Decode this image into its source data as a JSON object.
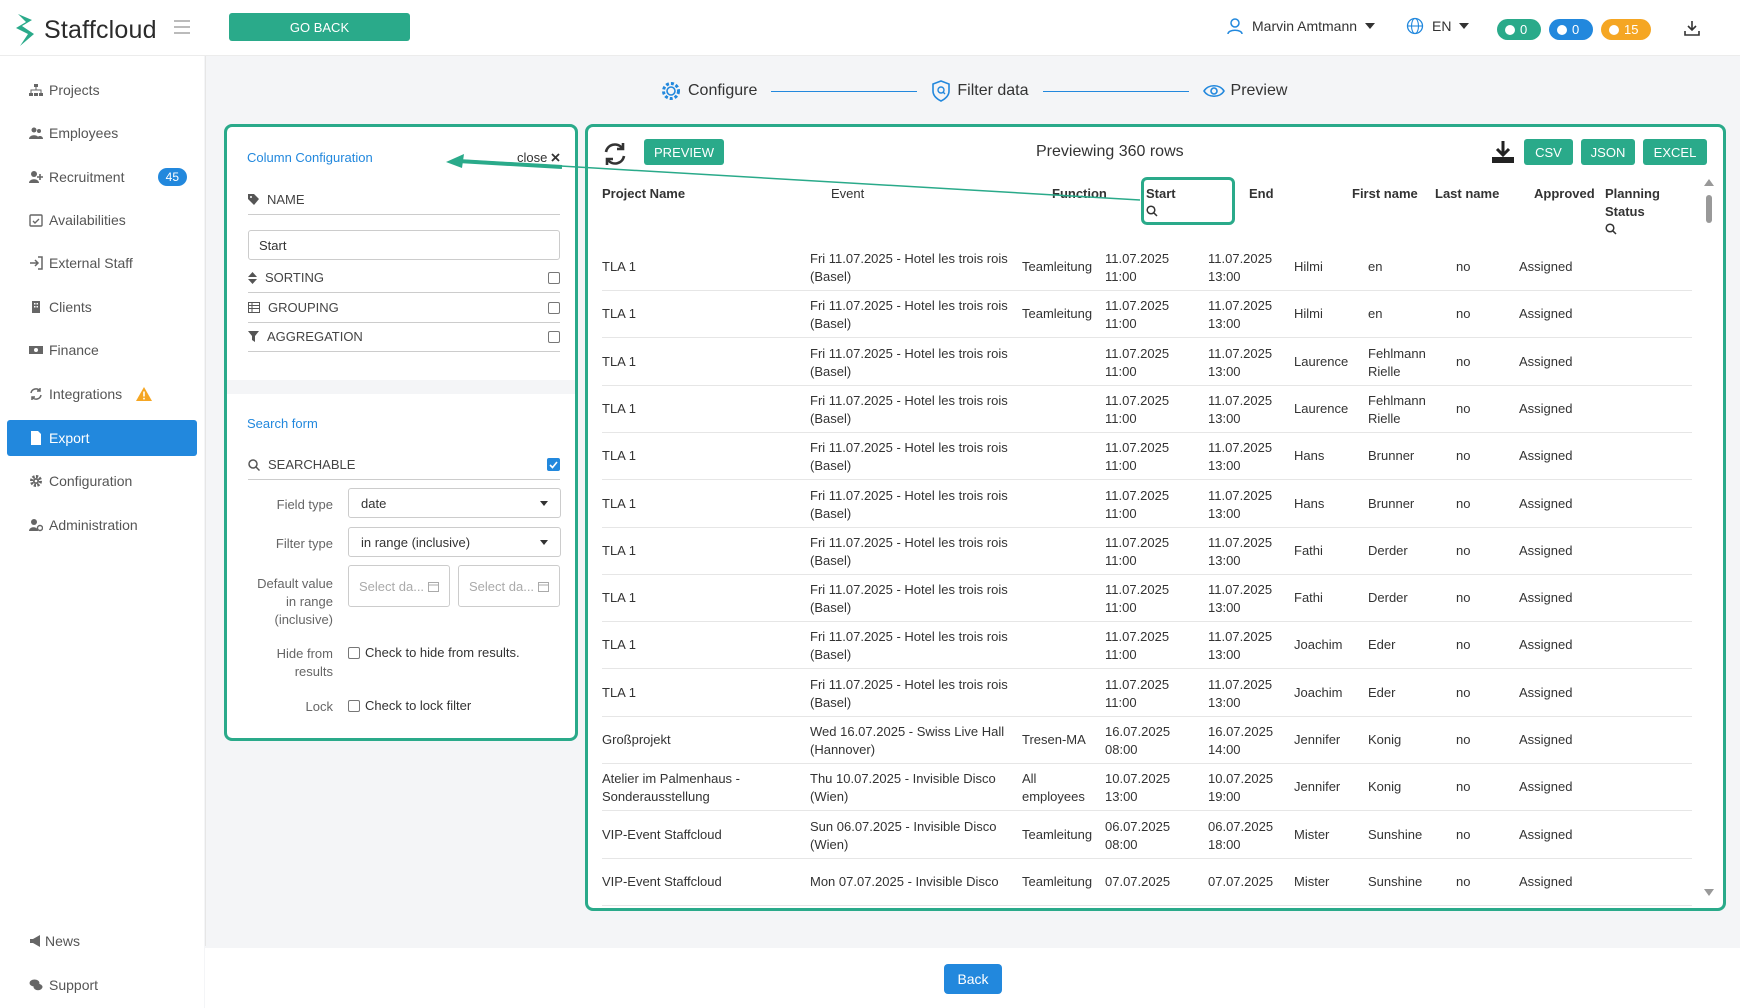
{
  "app": {
    "name": "Staffcloud"
  },
  "header": {
    "go_back_label": "GO BACK",
    "user_name": "Marvin Amtmann",
    "language": "EN",
    "badges": [
      {
        "value": "0",
        "color": "#2aaa8a"
      },
      {
        "value": "0",
        "color": "#2288dd"
      },
      {
        "value": "15",
        "color": "#f5a623"
      }
    ]
  },
  "sidebar": {
    "items": [
      {
        "label": "Projects",
        "icon": "sitemap-icon"
      },
      {
        "label": "Employees",
        "icon": "users-icon"
      },
      {
        "label": "Recruitment",
        "icon": "user-plus-icon",
        "badge": "45"
      },
      {
        "label": "Availabilities",
        "icon": "calendar-check-icon"
      },
      {
        "label": "External Staff",
        "icon": "sign-in-icon"
      },
      {
        "label": "Clients",
        "icon": "building-icon"
      },
      {
        "label": "Finance",
        "icon": "money-icon"
      },
      {
        "label": "Integrations",
        "icon": "sync-icon"
      },
      {
        "label": "Export",
        "icon": "file-icon",
        "active": true
      },
      {
        "label": "Configuration",
        "icon": "gear-icon"
      },
      {
        "label": "Administration",
        "icon": "user-cog-icon"
      }
    ],
    "footer": [
      {
        "label": "News",
        "icon": "megaphone-icon"
      },
      {
        "label": "Support",
        "icon": "comments-icon"
      }
    ]
  },
  "stepper": {
    "steps": [
      "Configure",
      "Filter data",
      "Preview"
    ]
  },
  "column_config": {
    "title": "Column Configuration",
    "close_label": "close",
    "name_label": "NAME",
    "name_value": "Start",
    "sorting_label": "SORTING",
    "grouping_label": "GROUPING",
    "aggregation_label": "AGGREGATION",
    "search_form_title": "Search form",
    "searchable_label": "SEARCHABLE",
    "field_type_label": "Field type",
    "field_type_value": "date",
    "filter_type_label": "Filter type",
    "filter_type_value": "in range (inclusive)",
    "default_value_label": "Default value in range (inclusive)",
    "date_placeholder_1": "Select da...",
    "date_placeholder_2": "Select da...",
    "hide_label": "Hide from results",
    "hide_text": "Check to hide from results.",
    "lock_label": "Lock",
    "lock_text": "Check to lock filter"
  },
  "preview": {
    "preview_button": "PREVIEW",
    "title": "Previewing 360 rows",
    "csv": "CSV",
    "json": "JSON",
    "excel": "EXCEL",
    "columns": [
      "Project Name",
      "Event",
      "Function",
      "Start",
      "End",
      "First name",
      "Last name",
      "Approved",
      "Planning Status"
    ],
    "rows": [
      [
        "TLA 1",
        "Fri 11.07.2025 - Hotel les trois rois (Basel)",
        "Teamleitung",
        "11.07.2025 11:00",
        "11.07.2025 13:00",
        "Hilmi",
        "en",
        "no",
        "Assigned"
      ],
      [
        "TLA 1",
        "Fri 11.07.2025 - Hotel les trois rois (Basel)",
        "Teamleitung",
        "11.07.2025 11:00",
        "11.07.2025 13:00",
        "Hilmi",
        "en",
        "no",
        "Assigned"
      ],
      [
        "TLA 1",
        "Fri 11.07.2025 - Hotel les trois rois (Basel)",
        "",
        "11.07.2025 11:00",
        "11.07.2025 13:00",
        "Laurence",
        "Fehlmann Rielle",
        "no",
        "Assigned"
      ],
      [
        "TLA 1",
        "Fri 11.07.2025 - Hotel les trois rois (Basel)",
        "",
        "11.07.2025 11:00",
        "11.07.2025 13:00",
        "Laurence",
        "Fehlmann Rielle",
        "no",
        "Assigned"
      ],
      [
        "TLA 1",
        "Fri 11.07.2025 - Hotel les trois rois (Basel)",
        "",
        "11.07.2025 11:00",
        "11.07.2025 13:00",
        "Hans",
        "Brunner",
        "no",
        "Assigned"
      ],
      [
        "TLA 1",
        "Fri 11.07.2025 - Hotel les trois rois (Basel)",
        "",
        "11.07.2025 11:00",
        "11.07.2025 13:00",
        "Hans",
        "Brunner",
        "no",
        "Assigned"
      ],
      [
        "TLA 1",
        "Fri 11.07.2025 - Hotel les trois rois (Basel)",
        "",
        "11.07.2025 11:00",
        "11.07.2025 13:00",
        "Fathi",
        "Derder",
        "no",
        "Assigned"
      ],
      [
        "TLA 1",
        "Fri 11.07.2025 - Hotel les trois rois (Basel)",
        "",
        "11.07.2025 11:00",
        "11.07.2025 13:00",
        "Fathi",
        "Derder",
        "no",
        "Assigned"
      ],
      [
        "TLA 1",
        "Fri 11.07.2025 - Hotel les trois rois (Basel)",
        "",
        "11.07.2025 11:00",
        "11.07.2025 13:00",
        "Joachim",
        "Eder",
        "no",
        "Assigned"
      ],
      [
        "TLA 1",
        "Fri 11.07.2025 - Hotel les trois rois (Basel)",
        "",
        "11.07.2025 11:00",
        "11.07.2025 13:00",
        "Joachim",
        "Eder",
        "no",
        "Assigned"
      ],
      [
        "Großprojekt",
        "Wed 16.07.2025 - Swiss Live Hall (Hannover)",
        "Tresen-MA",
        "16.07.2025 08:00",
        "16.07.2025 14:00",
        "Jennifer",
        "Konig",
        "no",
        "Assigned"
      ],
      [
        "Atelier im Palmenhaus - Sonderausstellung",
        "Thu 10.07.2025 - Invisible Disco (Wien)",
        "All employees",
        "10.07.2025 13:00",
        "10.07.2025 19:00",
        "Jennifer",
        "Konig",
        "no",
        "Assigned"
      ],
      [
        "VIP-Event Staffcloud",
        "Sun 06.07.2025 - Invisible Disco (Wien)",
        "Teamleitung",
        "06.07.2025 08:00",
        "06.07.2025 18:00",
        "Mister",
        "Sunshine",
        "no",
        "Assigned"
      ],
      [
        "VIP-Event Staffcloud",
        "Mon 07.07.2025 - Invisible Disco",
        "Teamleitung",
        "07.07.2025",
        "07.07.2025",
        "Mister",
        "Sunshine",
        "no",
        "Assigned"
      ]
    ]
  },
  "footer": {
    "back_label": "Back"
  },
  "colors": {
    "accent_green": "#2aaa8a",
    "accent_blue": "#2288dd",
    "warning": "#f5a623"
  }
}
